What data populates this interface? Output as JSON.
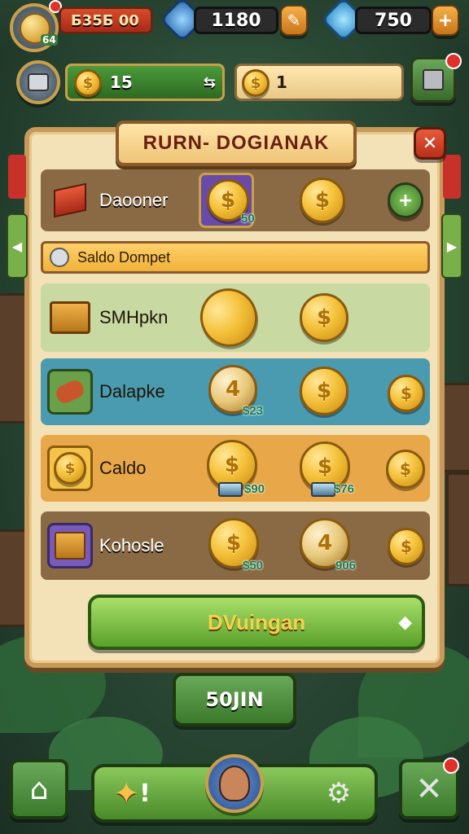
{
  "hud": {
    "level_badge": "64",
    "player_bar_text": "Б35Б 00",
    "gems_value": "1180",
    "diamonds_value": "750",
    "coins_value": "15",
    "secondary_value": "1"
  },
  "panel": {
    "title": "RURN- DOGIANAK",
    "saldo_bar": "Saldo Dompet",
    "rows": [
      {
        "label": "Daooner",
        "price": "50"
      },
      {
        "label": "SMHpkn",
        "price": ""
      },
      {
        "label": "Dalapke",
        "price": "$23"
      },
      {
        "label": "Caldo",
        "price_a": "$90",
        "price_b": "$76"
      },
      {
        "label": "Kohosle",
        "price_a": "$50",
        "price_b": "906"
      }
    ],
    "coin_symbols": {
      "dollar": "$",
      "four": "4"
    },
    "action_button": "DVuingan"
  },
  "bottom": {
    "secondary_button": "50JIN"
  },
  "colors": {
    "panel_bg": "#f3e1b8",
    "row_brown": "#8a6a44",
    "row_green": "#c8d9a2",
    "row_teal": "#4a9ab0",
    "row_orange": "#e8a84a",
    "action_green": "#7ac042"
  },
  "icons": [
    "home-icon",
    "puzzle-icon",
    "avatar-icon",
    "settings-icon",
    "close-icon",
    "plus-icon",
    "gem-icon",
    "diamond-icon",
    "pencil-icon",
    "robot-icon"
  ]
}
